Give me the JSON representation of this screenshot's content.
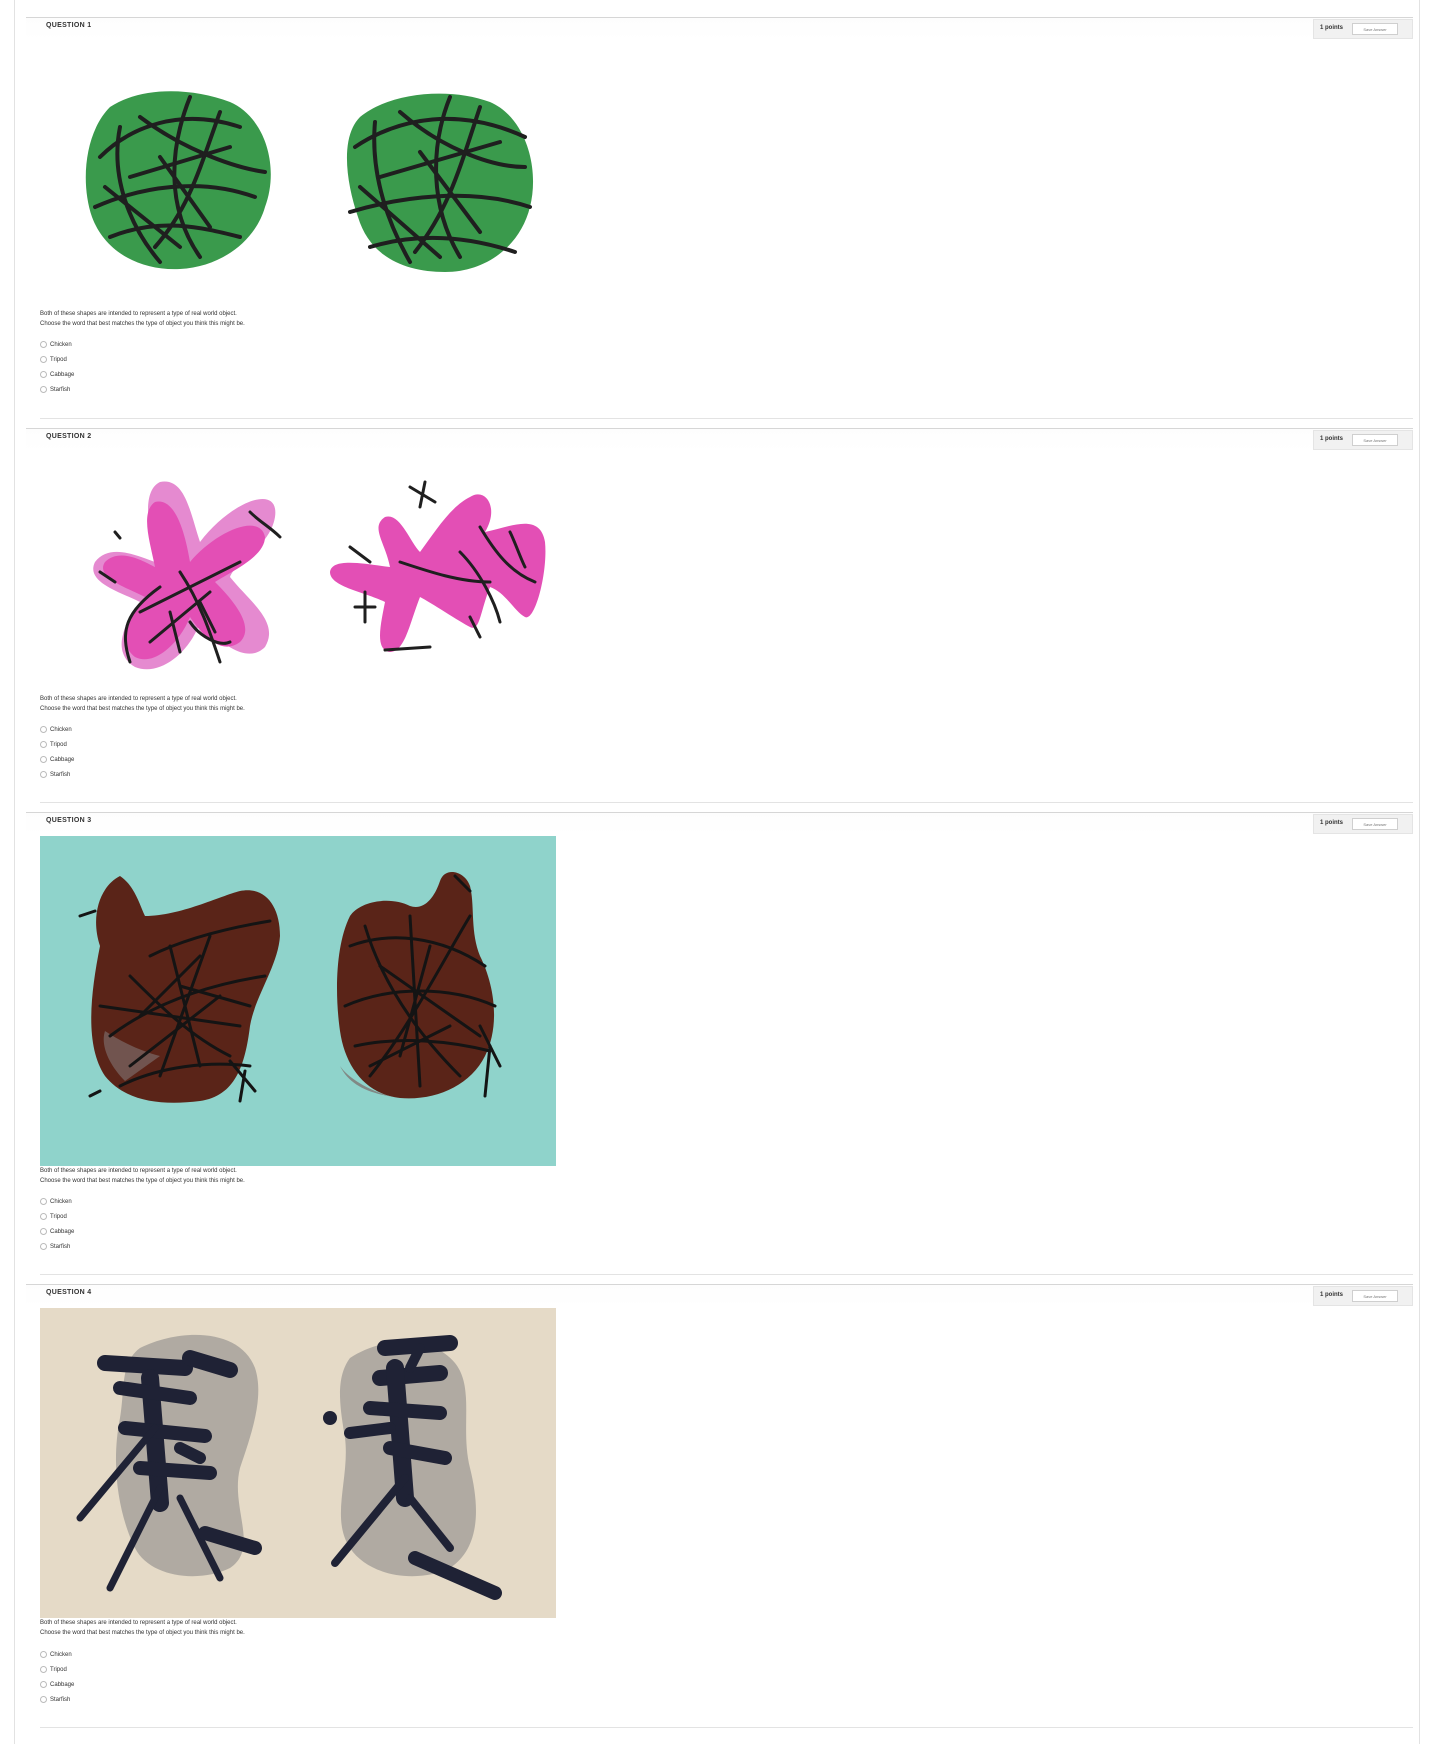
{
  "questions": [
    {
      "title": "QUESTION 1",
      "points": "1 points",
      "save_label": "Save Answer",
      "prompt_line1": "Both of these shapes are intended to represent a type of real world object.",
      "prompt_line2": "Choose the word that best matches the type of object you think this might be.",
      "options": [
        "Chicken",
        "Tripod",
        "Cabbage",
        "Starfish"
      ],
      "image": "two green cabbage-like shapes with black scribbles on white background"
    },
    {
      "title": "QUESTION 2",
      "points": "1 points",
      "save_label": "Save Answer",
      "prompt_line1": "Both of these shapes are intended to represent a type of real world object.",
      "prompt_line2": "Choose the word that best matches the type of object you think this might be.",
      "options": [
        "Chicken",
        "Tripod",
        "Cabbage",
        "Starfish"
      ],
      "image": "two pink starfish-like shapes with black scribbles on white background"
    },
    {
      "title": "QUESTION 3",
      "points": "1 points",
      "save_label": "Save Answer",
      "prompt_line1": "Both of these shapes are intended to represent a type of real world object.",
      "prompt_line2": "Choose the word that best matches the type of object you think this might be.",
      "options": [
        "Chicken",
        "Tripod",
        "Cabbage",
        "Starfish"
      ],
      "image": "two brown chicken-like shapes with black scribbles on turquoise background"
    },
    {
      "title": "QUESTION 4",
      "points": "1 points",
      "save_label": "Save Answer",
      "prompt_line1": "Both of these shapes are intended to represent a type of real world object.",
      "prompt_line2": "Choose the word that best matches the type of object you think this might be.",
      "options": [
        "Chicken",
        "Tripod",
        "Cabbage",
        "Starfish"
      ],
      "image": "two dark tripod-like shapes with grey shadow on beige background"
    }
  ],
  "colors": {
    "cabbage": "#3a9a4c",
    "starfish": "#e34fb5",
    "chicken": "#5a2418",
    "teal": "#8fd3cb",
    "beige": "#e5dac7",
    "ink": "#1f2235"
  }
}
